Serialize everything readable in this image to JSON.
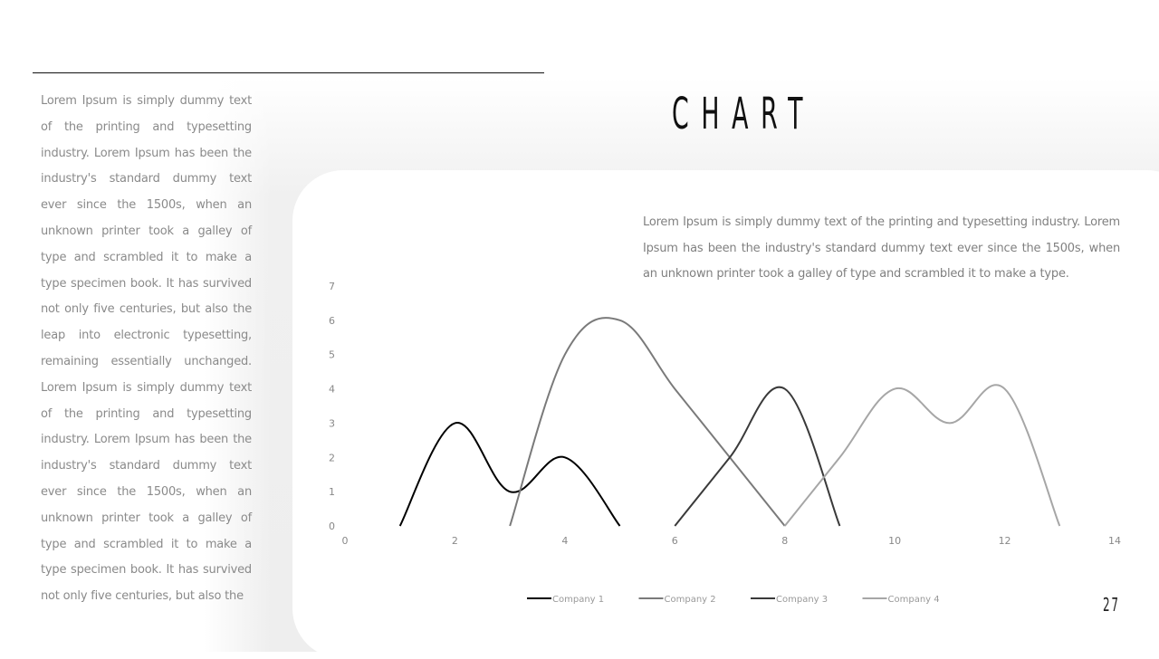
{
  "slide": {
    "title": "CHART",
    "page_number": "27",
    "side_text": "Lorem Ipsum is simply dummy text of the printing and typesetting industry. Lorem Ipsum has been the industry's standard dummy text ever since the 1500s, when an unknown printer took a galley of type and scrambled it to make a type specimen book. It has survived not only five centuries, but also the leap into electronic typesetting, remaining essentially unchanged. Lorem Ipsum is simply dummy text of the printing and typesetting industry. Lorem Ipsum has been the industry's standard dummy text ever since the 1500s, when an unknown printer took a galley of type and scrambled it to make a type specimen book. It has survived not only five centuries, but also the",
    "card_text": "Lorem Ipsum is simply dummy text of the printing and typesetting industry. Lorem Ipsum has been the industry's standard dummy text ever since the 1500s, when an unknown printer took a galley of type and scrambled it to make a type."
  },
  "chart_data": {
    "type": "scatter",
    "smooth": true,
    "title": "",
    "xlabel": "",
    "ylabel": "",
    "xlim": [
      0,
      14
    ],
    "ylim": [
      0,
      7
    ],
    "x_ticks": [
      0,
      2,
      4,
      6,
      8,
      10,
      12,
      14
    ],
    "y_ticks": [
      0,
      1,
      2,
      3,
      4,
      5,
      6,
      7
    ],
    "grid": false,
    "legend_position": "bottom",
    "series": [
      {
        "name": "Company 1",
        "color": "#000000",
        "points": [
          [
            1,
            0
          ],
          [
            2,
            3
          ],
          [
            3,
            1
          ],
          [
            4,
            2
          ],
          [
            5,
            0
          ]
        ]
      },
      {
        "name": "Company 2",
        "color": "#7a7a7a",
        "points": [
          [
            3,
            0
          ],
          [
            4,
            5
          ],
          [
            5,
            6
          ],
          [
            6,
            4
          ],
          [
            7,
            2
          ],
          [
            8,
            0
          ]
        ]
      },
      {
        "name": "Company 3",
        "color": "#3a3a3a",
        "points": [
          [
            6,
            0
          ],
          [
            7,
            2
          ],
          [
            8,
            4
          ],
          [
            9,
            0
          ]
        ]
      },
      {
        "name": "Company 4",
        "color": "#a6a6a6",
        "points": [
          [
            8,
            0
          ],
          [
            9,
            2
          ],
          [
            10,
            4
          ],
          [
            11,
            3
          ],
          [
            12,
            4
          ],
          [
            13,
            0
          ]
        ]
      }
    ]
  }
}
